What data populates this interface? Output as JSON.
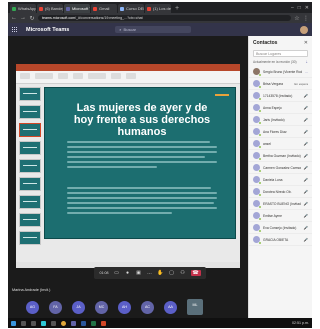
{
  "browser": {
    "tabs": [
      {
        "label": "WhatsApp",
        "fav": "green"
      },
      {
        "label": "(6) Bandeja de en...",
        "fav": "red"
      },
      {
        "label": "Microsoft Teams",
        "fav": "purple",
        "active": true
      },
      {
        "label": "Gmail",
        "fav": "red"
      },
      {
        "label": "Curso DEREC...",
        "fav": ""
      },
      {
        "label": "(1) Los derechos",
        "fav": "red"
      }
    ],
    "url_host": "teams.microsoft.com",
    "url_rest": "/_#/conversations/19:meeting_...?ctx=chat"
  },
  "teams": {
    "title": "Microsoft Teams",
    "search_placeholder": "Buscar"
  },
  "slide": {
    "title": "Las mujeres de ayer y de hoy frente a sus derechos humanos"
  },
  "callbar": {
    "time": "01:08"
  },
  "presenter": "Marina Andrade (Invit.)",
  "participants": [
    "AG",
    "FA",
    "JA",
    "MC",
    "AH",
    "AC",
    "AA",
    "ML"
  ],
  "contacts": {
    "title": "Contactos",
    "search_placeholder": "Buscar Lugares",
    "subtitle": "Actualmente en la reunión (30)",
    "items": [
      {
        "name": "Sergio Bruno (Vicente Rodrig.",
        "action": "...",
        "pic": true
      },
      {
        "name": "Brisa Vergara",
        "action": "En espera"
      },
      {
        "name": "17143578 (Invitado)",
        "action": "🎤"
      },
      {
        "name": "Anna Espejo",
        "action": "🎤"
      },
      {
        "name": "Jaris (Invitado)",
        "action": "🎤"
      },
      {
        "name": "Ana Flores Díaz",
        "action": "🎤"
      },
      {
        "name": "ansel",
        "action": "🎤"
      },
      {
        "name": "Bertha Guzman (Invitado)",
        "action": "🎤"
      },
      {
        "name": "Carmen Gonzalez Carmona",
        "action": "🎤"
      },
      {
        "name": "Daniela Luna",
        "action": "🎤"
      },
      {
        "name": "Dorotea Niredo Ob.",
        "action": "🎤"
      },
      {
        "name": "ERASTO BUENO (Invitado)",
        "action": "🎤"
      },
      {
        "name": "Emilse Ayme",
        "action": "🎤"
      },
      {
        "name": "Eva Consejo (Invitado)",
        "action": "🎤"
      },
      {
        "name": "GRACIA OBIETA",
        "action": "🎤"
      }
    ]
  },
  "taskbar": {
    "time": "02:51 p.m."
  }
}
